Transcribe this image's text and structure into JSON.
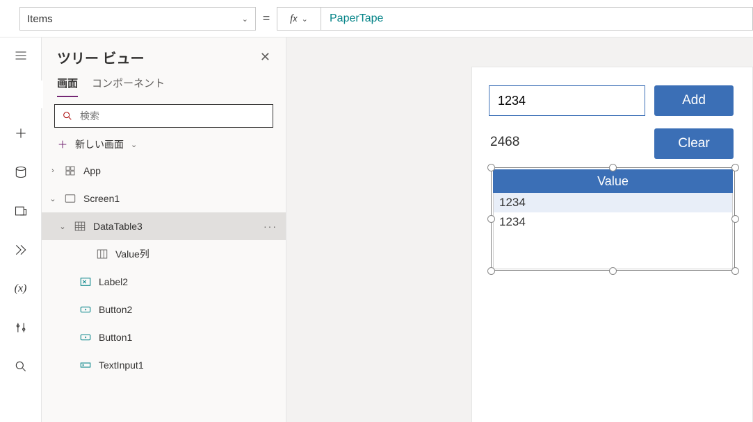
{
  "topbar": {
    "property_name": "Items",
    "formula_value": "PaperTape"
  },
  "treeview": {
    "title": "ツリー ビュー",
    "tab_screens": "画面",
    "tab_components": "コンポーネント",
    "search_placeholder": "検索",
    "new_screen": "新しい画面",
    "nodes": {
      "app": "App",
      "screen1": "Screen1",
      "datatable": "DataTable3",
      "value_col": "Value列",
      "label2": "Label2",
      "button2": "Button2",
      "button1": "Button1",
      "textinput1": "TextInput1"
    }
  },
  "canvas": {
    "text_input_value": "1234",
    "label_value": "2468",
    "button_add": "Add",
    "button_clear": "Clear",
    "datatable_header": "Value",
    "datatable_rows": [
      "1234",
      "1234"
    ]
  }
}
